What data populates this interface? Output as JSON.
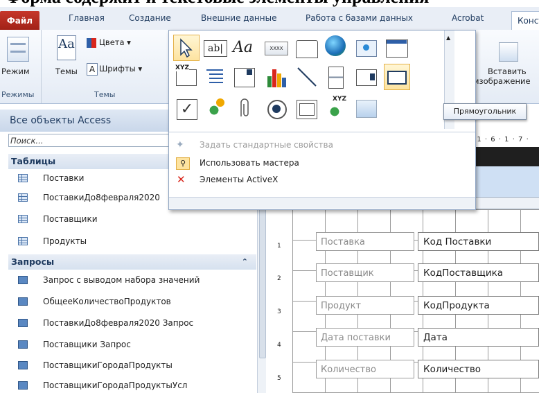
{
  "caption": "Форма содержит и текстовые элементы управления",
  "tabs": {
    "file": "Файл",
    "home": "Главная",
    "create": "Создание",
    "external": "Внешние данные",
    "dbtools": "Работа с базами данных",
    "acrobat": "Acrobat",
    "design": "Констр"
  },
  "ribbon": {
    "mode_label": "Режим",
    "modes_group": "Режимы",
    "themes_label": "Темы",
    "colors_label": "Цвета ▾",
    "fonts_label": "Шрифты ▾",
    "themes_group": "Темы",
    "insert_image_line1": "Вставить",
    "insert_image_line2": "изображение"
  },
  "gallery": {
    "menu_default_props": "Задать стандартные свойства",
    "menu_use_wizards": "Использовать мастера",
    "menu_activex": "Элементы ActiveX",
    "textbox_glyph": "ab|",
    "label_glyph": "Aa",
    "combo_glyph": "XXXX",
    "xyz": "XYZ"
  },
  "tooltip": "Прямоугольник",
  "nav": {
    "header": "Все объекты Access",
    "search_placeholder": "Поиск...",
    "section_tables": "Таблицы",
    "tables": [
      "Поставки",
      "ПоставкиДо8февраля2020",
      "Поставщики",
      "Продукты"
    ],
    "section_queries": "Запросы",
    "queries": [
      "Запрос с выводом набора значений",
      "ОбщееКоличествоПродуктов",
      "ПоставкиДо8февраля2020 Запрос",
      "Поставщики Запрос",
      "ПоставщикиГородаПродукты",
      "ПоставщикиГородаПродуктыУсл"
    ]
  },
  "design": {
    "ruler_top": "· 1 · 6 · 1 · 7 ·",
    "ruler_marks": [
      "1",
      "2",
      "3",
      "4",
      "5"
    ],
    "fields": [
      {
        "label": "Поставка",
        "value": "Код Поставки"
      },
      {
        "label": "Поставщик",
        "value": "КодПоставщика"
      },
      {
        "label": "Продукт",
        "value": "КодПродукта"
      },
      {
        "label": "Дата поставки",
        "value": "Дата"
      },
      {
        "label": "Количество",
        "value": "Количество"
      }
    ]
  },
  "colors": {
    "file_tab": "#b52a1e",
    "accent": "#1e3a5f",
    "selection": "#fde3a0"
  }
}
